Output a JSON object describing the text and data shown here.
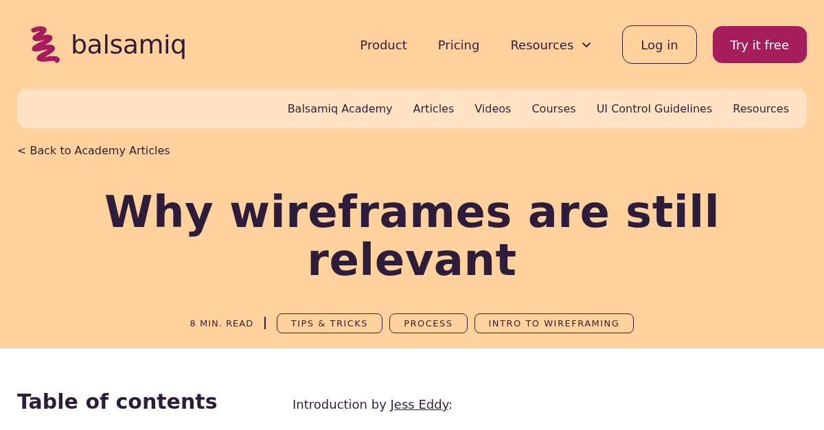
{
  "logo": {
    "text": "balsamiq"
  },
  "nav": [
    {
      "label": "Product",
      "kind": "link"
    },
    {
      "label": "Pricing",
      "kind": "link"
    },
    {
      "label": "Resources",
      "kind": "dropdown"
    }
  ],
  "login": "Log in",
  "cta": "Try it free",
  "subnav": [
    "Balsamiq Academy",
    "Articles",
    "Videos",
    "Courses",
    "UI Control Guidelines",
    "Resources"
  ],
  "back_link": "< Back to Academy Articles",
  "title": "Why wireframes are still relevant",
  "read_time": "8 MIN. READ",
  "tags": [
    "TIPS & TRICKS",
    "PROCESS",
    "INTRO TO WIREFRAMING"
  ],
  "toc_heading": "Table of contents",
  "intro": {
    "prefix": "Introduction by",
    "link": "Jess Eddy",
    "suffix": ":"
  }
}
